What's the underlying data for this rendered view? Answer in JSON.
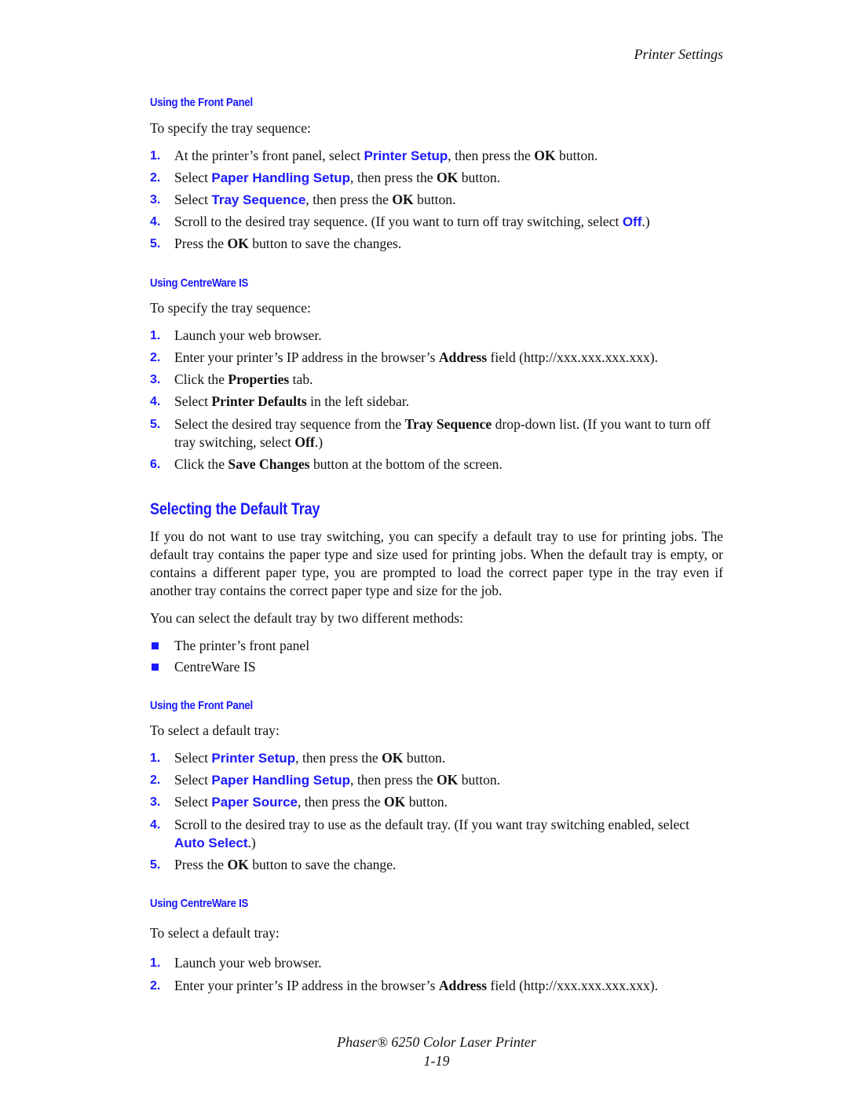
{
  "header": {
    "running_title": "Printer Settings"
  },
  "tray_sequence": {
    "front_panel": {
      "heading": "Using the Front Panel",
      "intro": "To specify the tray sequence:",
      "steps": [
        {
          "num": "1.",
          "pre": "At the printer’s front panel, select ",
          "ui": "Printer Setup",
          "mid": ", then press the ",
          "bold": "OK",
          "post": " button."
        },
        {
          "num": "2.",
          "pre": "Select ",
          "ui": "Paper Handling Setup",
          "mid": ", then press the ",
          "bold": "OK",
          "post": " button."
        },
        {
          "num": "3.",
          "pre": "Select ",
          "ui": "Tray Sequence",
          "mid": ", then press the ",
          "bold": "OK",
          "post": " button."
        },
        {
          "num": "4.",
          "pre": "Scroll to the desired tray sequence. (If you want to turn off tray switching, select ",
          "ui": "Off",
          "post": ".)"
        },
        {
          "num": "5.",
          "pre": "Press the ",
          "bold": "OK",
          "post": " button to save the changes."
        }
      ]
    },
    "centreware": {
      "heading": "Using CentreWare IS",
      "intro": "To specify the tray sequence:",
      "steps": [
        {
          "num": "1.",
          "text": "Launch your web browser."
        },
        {
          "num": "2.",
          "pre": "Enter your printer’s IP address in the browser’s ",
          "bold": "Address",
          "post": " field (http://xxx.xxx.xxx.xxx)."
        },
        {
          "num": "3.",
          "pre": "Click the ",
          "bold": "Properties",
          "post": " tab."
        },
        {
          "num": "4.",
          "pre": "Select ",
          "bold": "Printer Defaults",
          "post": " in the left sidebar."
        },
        {
          "num": "5.",
          "pre": "Select the desired tray sequence from the ",
          "bold": "Tray Sequence",
          "mid": " drop-down list. (If you want to turn off tray switching, select ",
          "bold2": "Off",
          "post": ".)"
        },
        {
          "num": "6.",
          "pre": "Click the ",
          "bold": "Save Changes",
          "post": " button at the bottom of the screen."
        }
      ]
    }
  },
  "default_tray": {
    "title": "Selecting the Default Tray",
    "paragraph": "If you do not want to use tray switching, you can specify a default tray to use for printing jobs. The default tray contains the paper type and size used for printing jobs. When the default tray is empty, or contains a different paper type, you are prompted to load the correct paper type in the tray even if another tray contains the correct paper type and size for the job.",
    "methods_intro": "You can select the default tray by two different methods:",
    "methods": [
      "The printer’s front panel",
      "CentreWare IS"
    ],
    "front_panel": {
      "heading": "Using the Front Panel",
      "intro": "To select a default tray:",
      "steps": [
        {
          "num": "1.",
          "pre": "Select ",
          "ui": "Printer Setup",
          "mid": ", then press the ",
          "bold": "OK",
          "post": " button."
        },
        {
          "num": "2.",
          "pre": "Select ",
          "ui": "Paper Handling Setup",
          "mid": ", then press the ",
          "bold": "OK",
          "post": " button."
        },
        {
          "num": "3.",
          "pre": "Select ",
          "ui": "Paper Source",
          "mid": ", then press the ",
          "bold": "OK",
          "post": " button."
        },
        {
          "num": "4.",
          "pre": "Scroll to the desired tray to use as the default tray. (If you want tray switching enabled, select ",
          "ui": "Auto Select",
          "post": ".)"
        },
        {
          "num": "5.",
          "pre": "Press the ",
          "bold": "OK",
          "post": " button to save the change."
        }
      ]
    },
    "centreware": {
      "heading": "Using CentreWare IS",
      "intro": "To select a default tray:",
      "steps": [
        {
          "num": "1.",
          "text": "Launch your web browser."
        },
        {
          "num": "2.",
          "pre": "Enter your printer’s IP address in the browser’s ",
          "bold": "Address",
          "post": " field (http://xxx.xxx.xxx.xxx)."
        }
      ]
    }
  },
  "footer": {
    "product": "Phaser® 6250 Color Laser Printer",
    "page_number": "1-19"
  },
  "colors": {
    "accent": "#1a1aff",
    "text": "#111111"
  }
}
